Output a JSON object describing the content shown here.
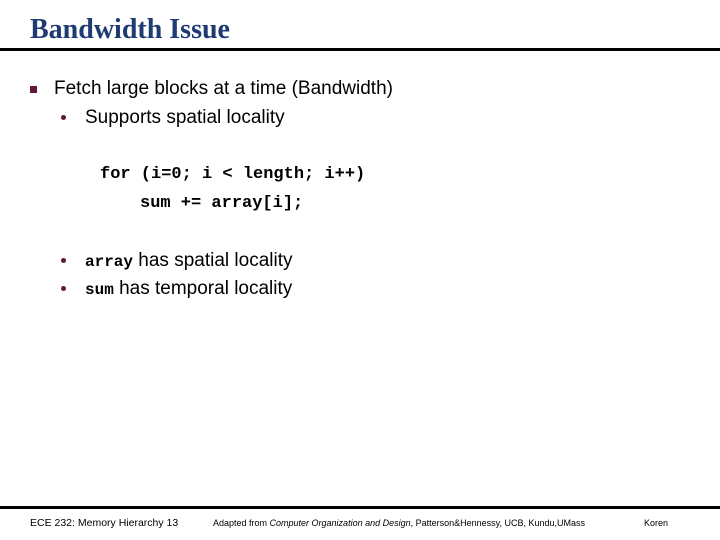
{
  "slide": {
    "title": "Bandwidth Issue",
    "title_color": "#1f3b73",
    "background": "#ffffff",
    "rule_color": "#000000",
    "bullet_marker_color": "#61183a"
  },
  "body": {
    "bullet1": {
      "marker": "square-bullet-icon",
      "text": "Fetch large blocks at a time (Bandwidth)"
    },
    "bullet2": {
      "marker": "round-bullet-icon",
      "text": "Supports spatial locality"
    },
    "code": {
      "line1": "for (i=0; i < length; i++)",
      "line2": "sum += array[i];"
    },
    "bullet3": {
      "marker": "round-bullet-icon",
      "code_token": "array",
      "text": " has spatial locality"
    },
    "bullet4": {
      "marker": "round-bullet-icon",
      "code_token": "sum",
      "text": " has temporal locality"
    }
  },
  "footer": {
    "left": "ECE 232: Memory Hierarchy 13",
    "credit_prefix": "Adapted from ",
    "credit_book": "Computer Organization and Design",
    "credit_suffix": ", Patterson&Hennessy, UCB, Kundu,UMass",
    "right": "Koren"
  }
}
